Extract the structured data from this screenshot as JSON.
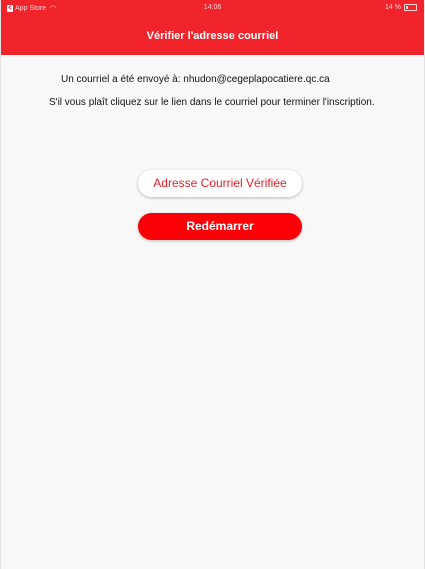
{
  "status_bar": {
    "back_app": "App Store",
    "wifi_icon": "wifi-icon",
    "time": "14:06",
    "battery": "14 %"
  },
  "nav": {
    "title": "Vérifier l'adresse courriel"
  },
  "message": {
    "line1": "Un courriel a été envoyé à: nhudon@cegeplapocatiere.qc.ca",
    "line2": "S'il vous plaît cliquez sur le lien dans le courriel pour terminer l'inscription."
  },
  "buttons": {
    "verified_label": "Adresse Courriel Vérifiée",
    "restart_label": "Redémarrer"
  },
  "colors": {
    "header": "#f1242c",
    "primary_button": "#fc0007",
    "secondary_text": "#ee1c24"
  }
}
